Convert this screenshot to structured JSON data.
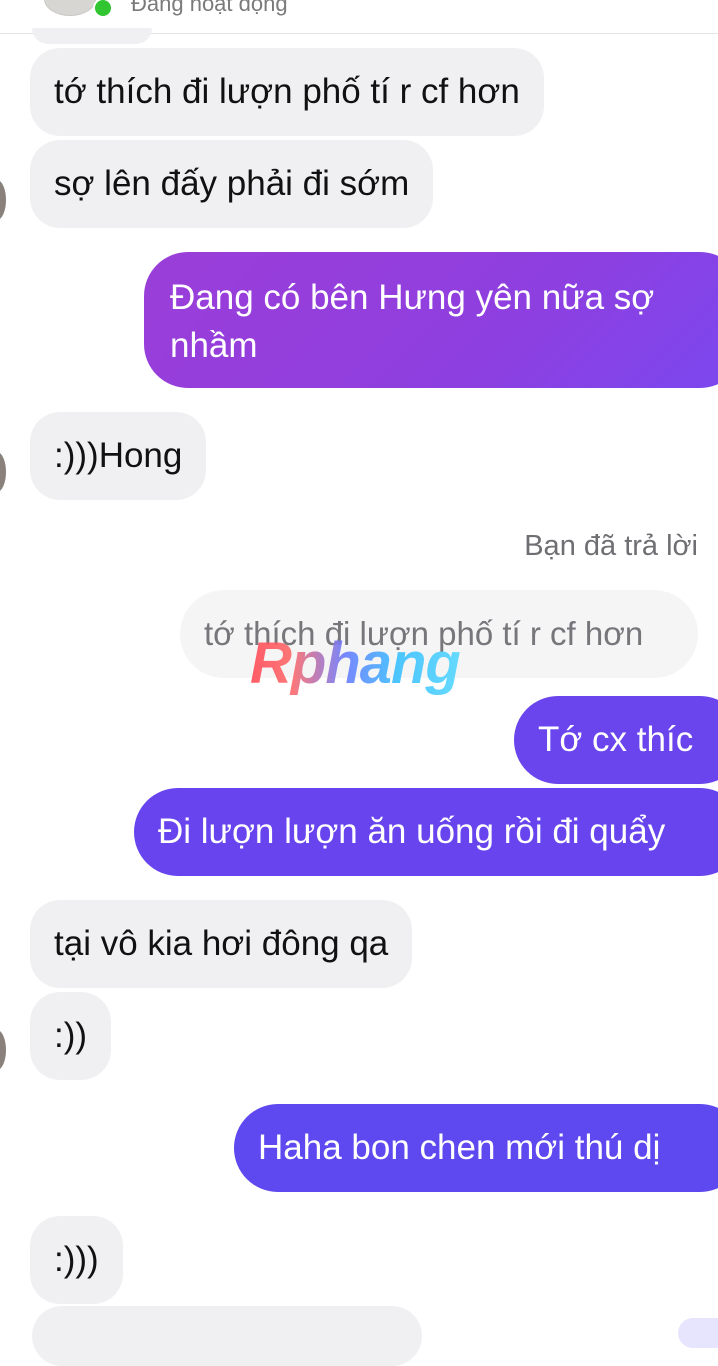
{
  "header": {
    "status": "Đang hoạt động"
  },
  "messages": [
    {
      "side": "in",
      "text": "tớ thích đi lượn phố tí r cf hơn"
    },
    {
      "side": "in",
      "text": "sợ lên đấy phải đi sớm"
    },
    {
      "side": "out",
      "lines": [
        "Đang có bên Hưng yên nữa sợ",
        "nhầm"
      ]
    },
    {
      "side": "in",
      "text": ":)))Hong"
    },
    {
      "side": "out",
      "text": "Tớ cx thíc"
    },
    {
      "side": "out",
      "text": "Đi lượn lượn ăn uống rồi đi quẩy"
    },
    {
      "side": "in",
      "text": "tại vô kia hơi đông qa"
    },
    {
      "side": "in",
      "text": ":))"
    },
    {
      "side": "out",
      "text": "Haha bon chen mới thú dị"
    },
    {
      "side": "in",
      "text": ":)))"
    }
  ],
  "reply": {
    "label": "Bạn đã trả lời",
    "quoted_text": "tớ thích đi lượn phố tí r cf hơn"
  },
  "watermark": "Rphang",
  "colors": {
    "incoming_bg": "#f0f0f2",
    "outgoing_purple": "#8e3fe0",
    "outgoing_blue": "#5e48ef",
    "online_green": "#31c531"
  }
}
